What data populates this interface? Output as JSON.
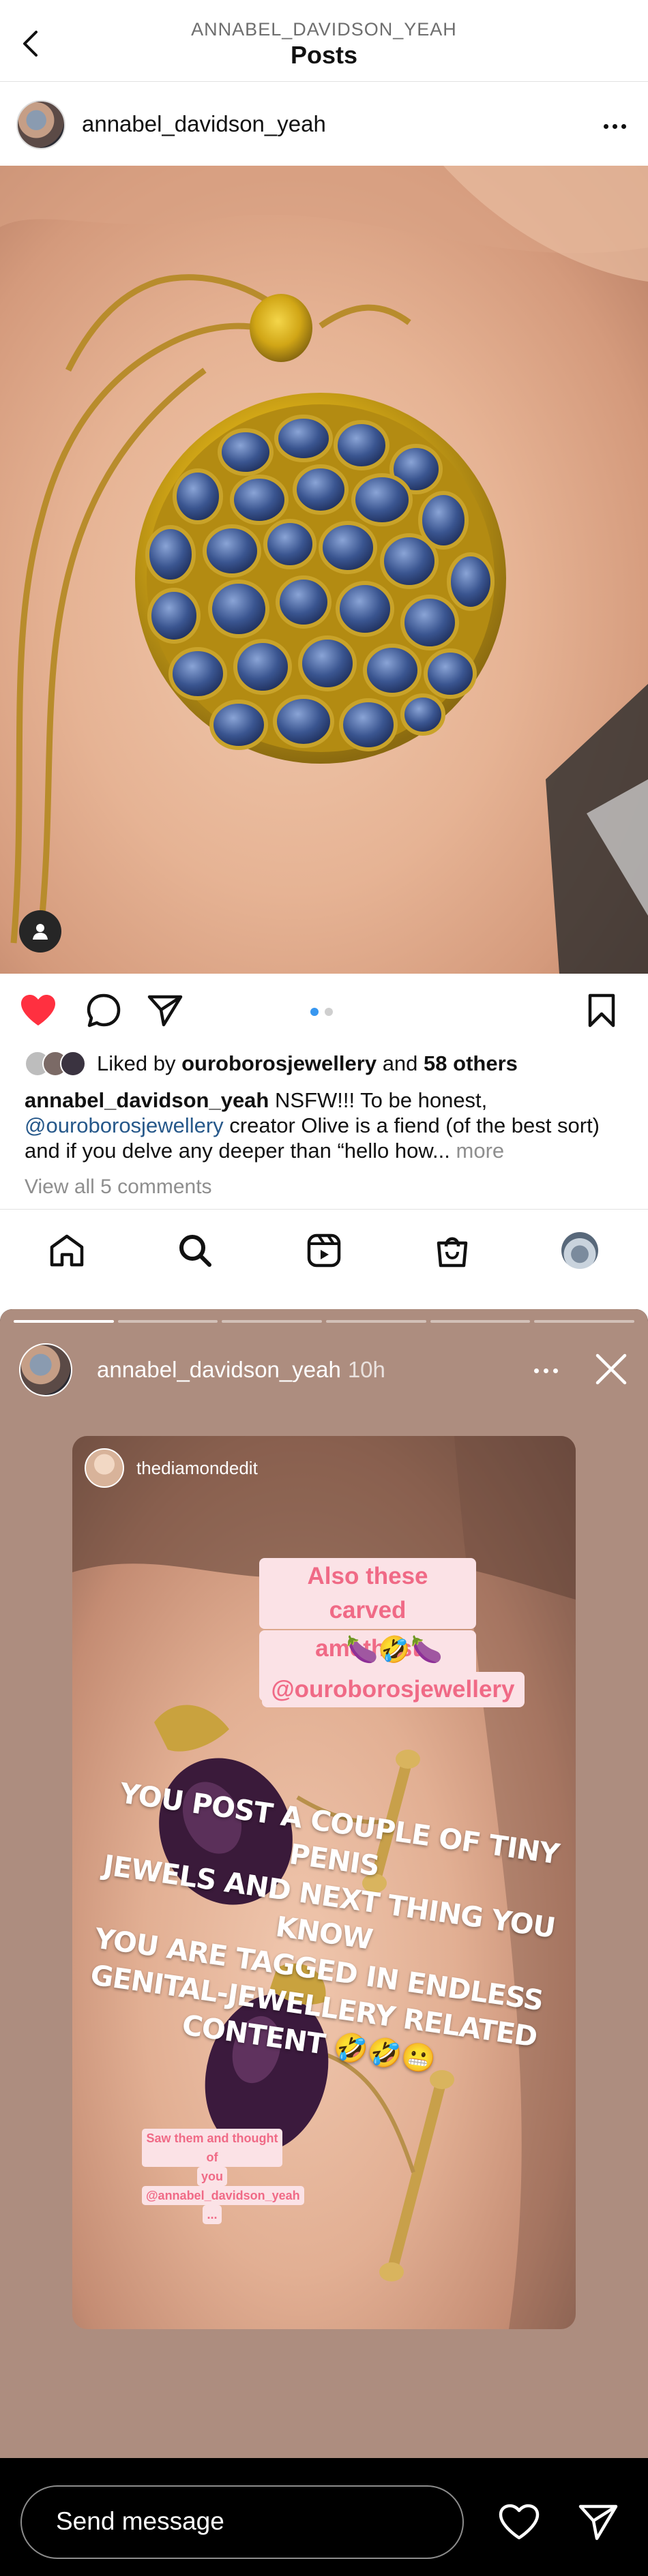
{
  "header": {
    "kicker": "ANNABEL_DAVIDSON_YEAH",
    "title": "Posts",
    "back_icon": "chevron-left-icon"
  },
  "post": {
    "author": "annabel_davidson_yeah",
    "more_icon": "ellipsis-icon",
    "image_description_icon": "user-tag-icon",
    "actions": {
      "like_icon": "heart-filled-icon",
      "like_color": "#ff3040",
      "comment_icon": "comment-icon",
      "share_icon": "paper-plane-icon",
      "save_icon": "bookmark-icon"
    },
    "carousel": {
      "count": 2,
      "active_index": 0,
      "active_color": "#3897f0"
    },
    "likes": {
      "prefix": "Liked by",
      "first_user": "ouroborosjewellery",
      "conjunction": "and",
      "others": "58 others"
    },
    "caption": {
      "author": "annabel_davidson_yeah",
      "text_1": "NSFW!!! To be honest,",
      "mention": "@ouroborosjewellery",
      "text_2": "creator Olive is a fiend (of the best sort) and if you delve any deeper than “hello how...",
      "more": "more"
    },
    "view_comments": "View all 5 comments"
  },
  "bottom_nav": {
    "items": [
      "home-icon",
      "search-icon",
      "reels-icon",
      "shop-icon",
      "profile-avatar"
    ]
  },
  "story": {
    "progress_segments": 6,
    "progress_done": 1,
    "user": "annabel_davidson_yeah",
    "time": "10h",
    "shared_user": "thediamondedit",
    "sticker_1_lines": [
      "Also these carved",
      "amethyst cufflinks"
    ],
    "emoji_row": "🍆🤣🍆",
    "sticker_2": "@ouroborosjewellery",
    "big_text_lines": [
      "YOU POST A COUPLE OF TINY PENIS",
      "JEWELS AND NEXT THING YOU KNOW",
      "YOU ARE TAGGED IN ENDLESS",
      "GENITAL-JEWELLERY RELATED",
      "CONTENT 🤣🤣😬"
    ],
    "small_sticker_lines": [
      "Saw them and thought of",
      "you",
      "@annabel_davidson_yeah",
      "..."
    ],
    "message_placeholder": "Send message",
    "background_color": "#ad8d7f"
  }
}
